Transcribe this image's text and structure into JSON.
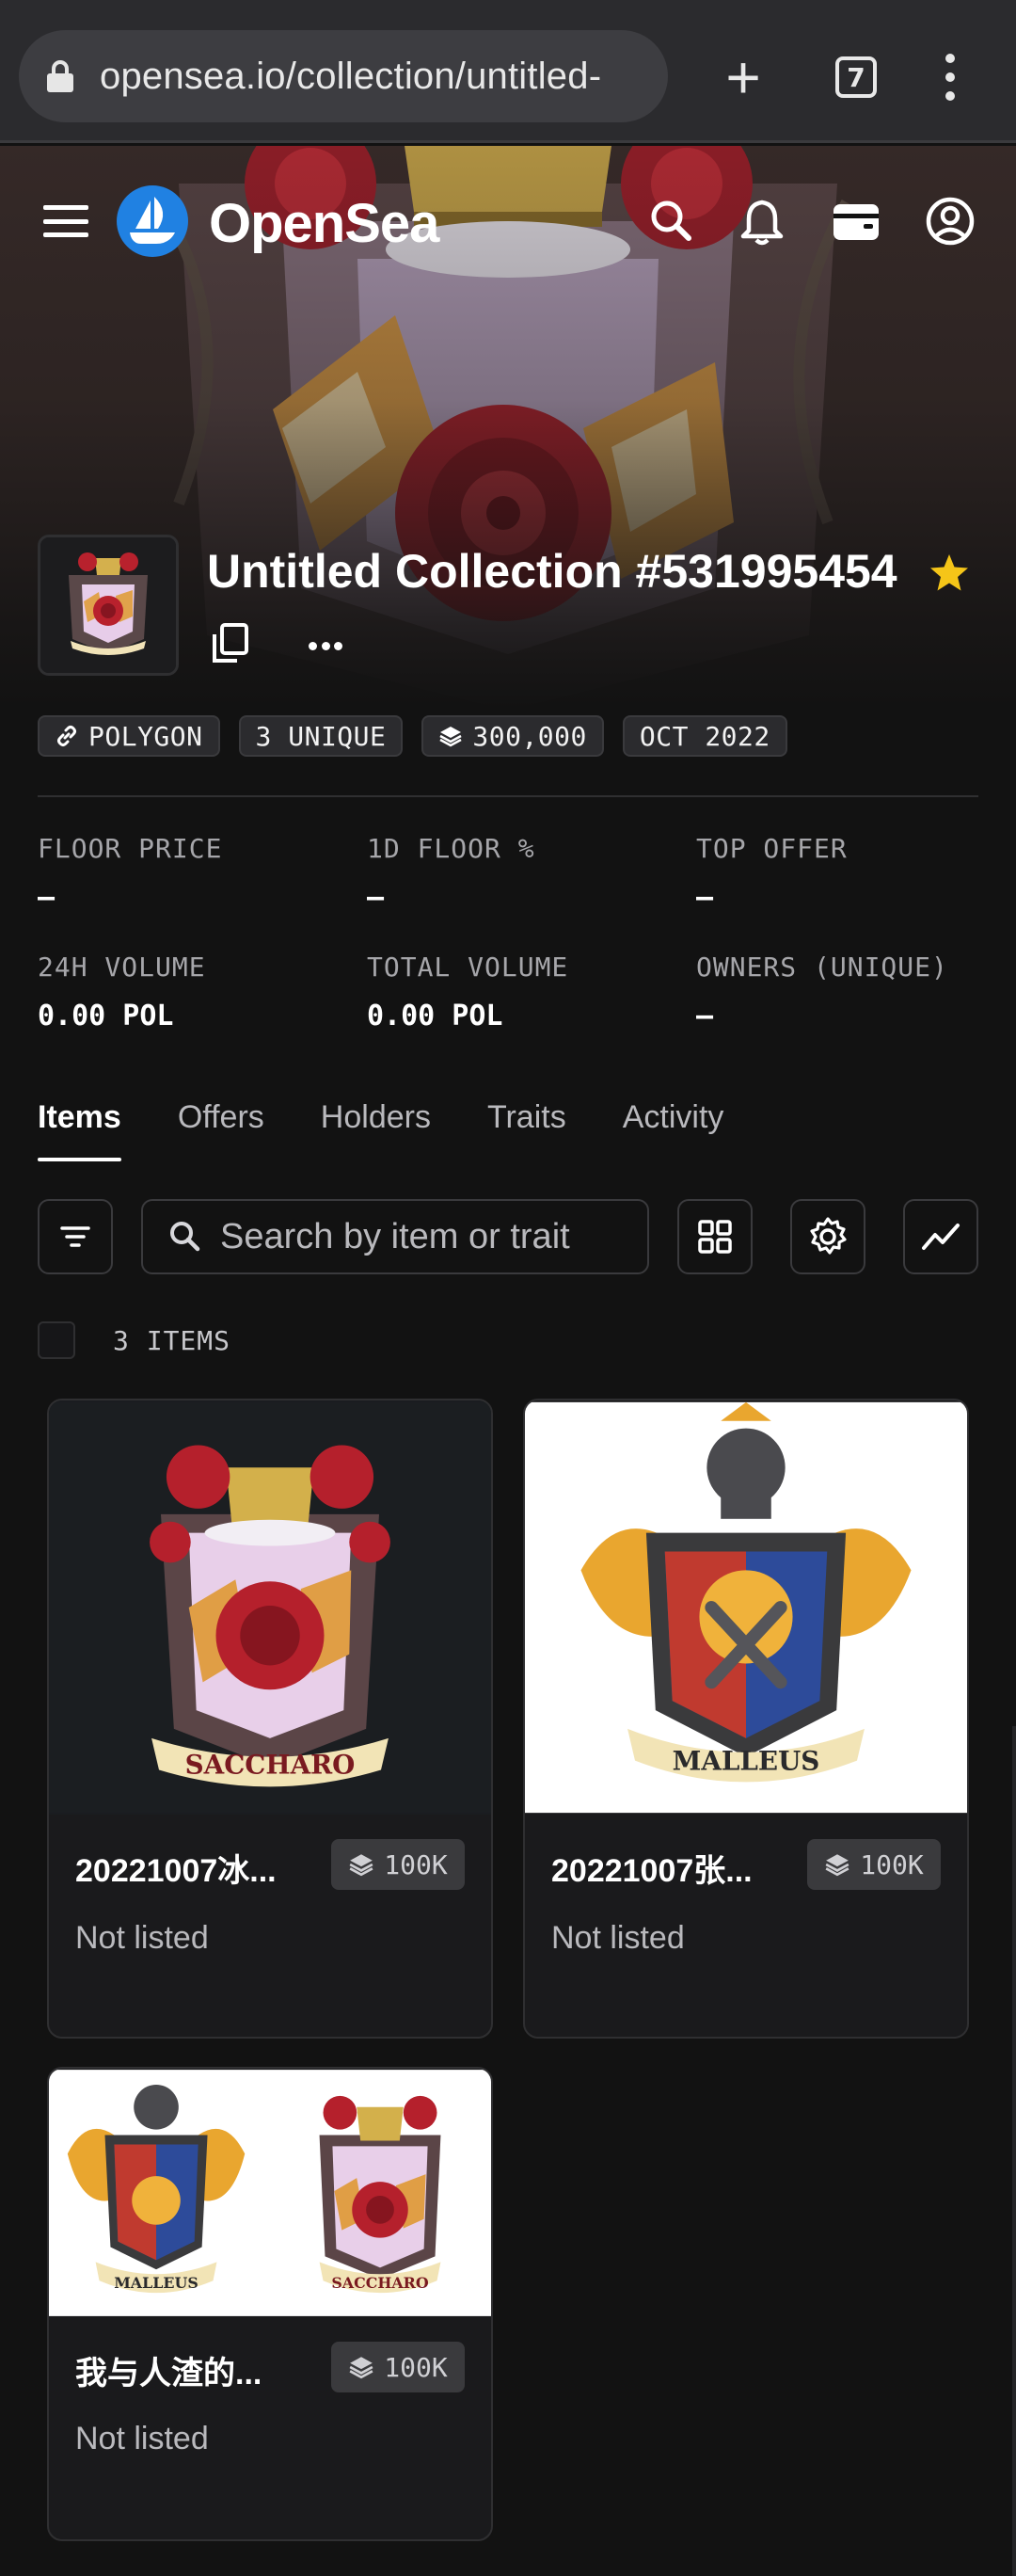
{
  "browser": {
    "url": "opensea.io/collection/untitled-",
    "tab_count": "7"
  },
  "nav": {
    "brand": "OpenSea",
    "icons": [
      "hamburger-icon",
      "search-icon",
      "bell-icon",
      "wallet-icon",
      "account-icon"
    ]
  },
  "collection": {
    "title": "Untitled Collection #531995454",
    "badges": {
      "chain": "POLYGON",
      "unique": "3 UNIQUE",
      "supply": "300,000",
      "date": "OCT 2022"
    }
  },
  "stats": [
    {
      "label": "FLOOR PRICE",
      "value": "–"
    },
    {
      "label": "1D FLOOR %",
      "value": "–"
    },
    {
      "label": "TOP OFFER",
      "value": "–"
    },
    {
      "label": "24H VOLUME",
      "value": "0.00 POL"
    },
    {
      "label": "TOTAL VOLUME",
      "value": "0.00 POL"
    },
    {
      "label": "OWNERS (UNIQUE)",
      "value": "–"
    }
  ],
  "tabs": [
    "Items",
    "Offers",
    "Holders",
    "Traits",
    "Activity"
  ],
  "active_tab": "Items",
  "search": {
    "placeholder": "Search by item or trait"
  },
  "items_count": "3 ITEMS",
  "items": [
    {
      "name": "20221007冰...",
      "supply": "100K",
      "status": "Not listed",
      "art": "SACCHARO"
    },
    {
      "name": "20221007张...",
      "supply": "100K",
      "status": "Not listed",
      "art": "MALLEUS"
    },
    {
      "name": "我与人渣的...",
      "supply": "100K",
      "status": "Not listed",
      "art_left": "MALLEUS",
      "art_right": "SACCHARO"
    }
  ],
  "colors": {
    "background": "#121212",
    "brand_blue": "#2081e2",
    "star": "#f5c518"
  }
}
